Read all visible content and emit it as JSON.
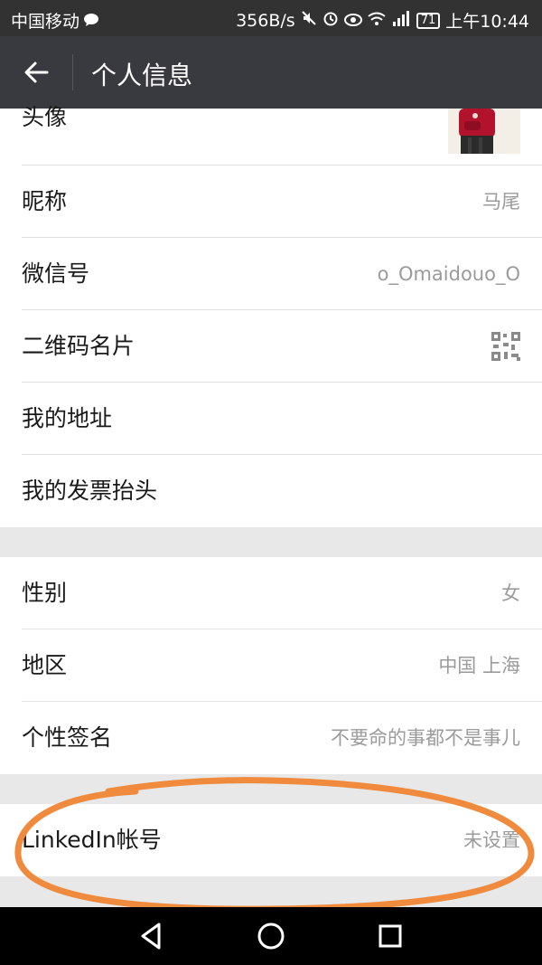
{
  "status_bar": {
    "carrier": "中国移动",
    "speed": "356B/s",
    "battery": "71",
    "time": "上午10:44"
  },
  "header": {
    "title": "个人信息"
  },
  "profile": {
    "avatar_label": "头像",
    "nickname_label": "昵称",
    "nickname": "马尾",
    "wechat_id_label": "微信号",
    "wechat_id": "o_Omaidouo_O",
    "qr_label": "二维码名片",
    "address_label": "我的地址",
    "invoice_label": "我的发票抬头"
  },
  "details": {
    "gender_label": "性别",
    "gender": "女",
    "region_label": "地区",
    "region": "中国 上海",
    "signature_label": "个性签名",
    "signature": "不要命的事都不是事儿"
  },
  "linkedin": {
    "label": "LinkedIn帐号",
    "value": "未设置"
  },
  "colors": {
    "header_bg": "#393a3f",
    "status_bg": "#323232",
    "annotation": "#f08a3c"
  }
}
